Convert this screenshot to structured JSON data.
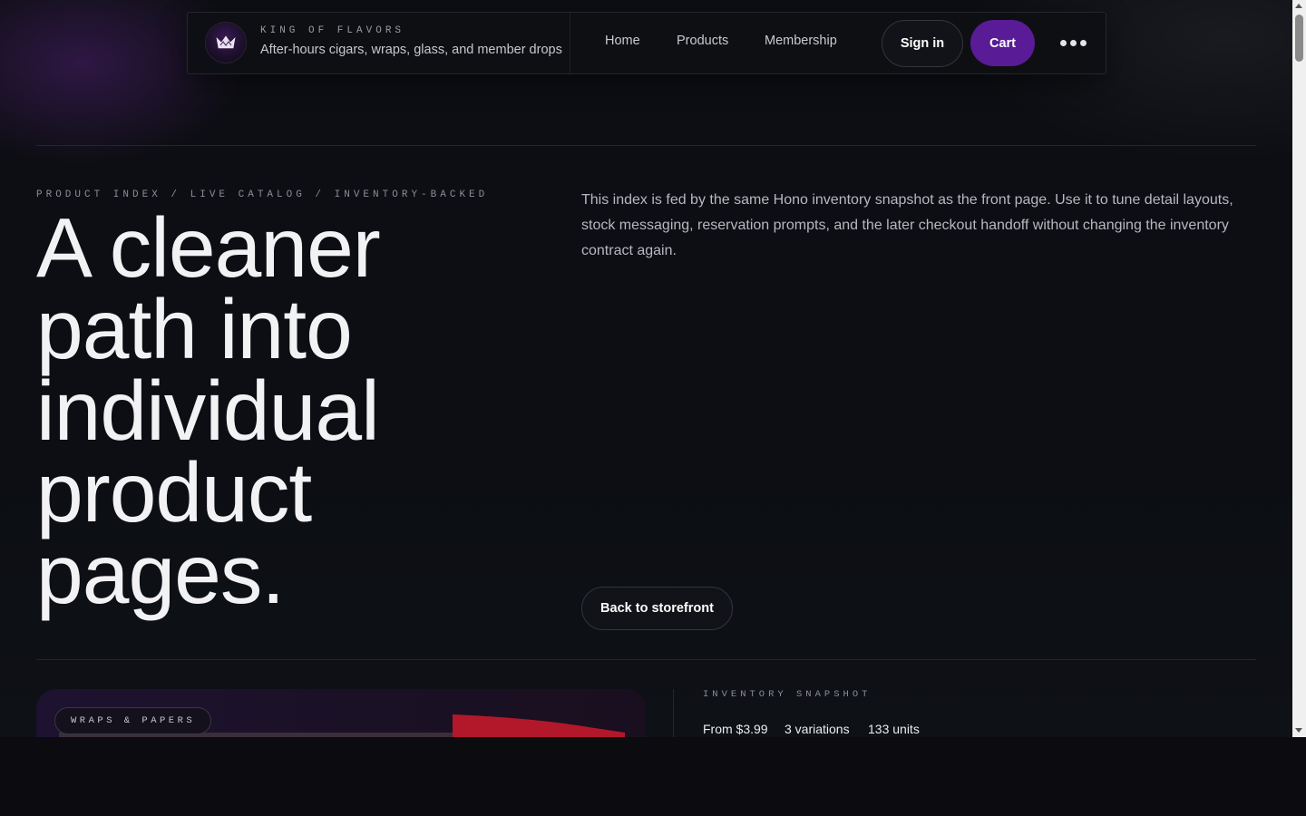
{
  "header": {
    "brand_name": "KING OF FLAVORS",
    "brand_tagline": "After-hours cigars, wraps, glass, and member drops",
    "nav": [
      "Home",
      "Products",
      "Membership"
    ],
    "sign_in_label": "Sign in",
    "cart_label": "Cart",
    "more_icon": "more-horizontal-icon",
    "logo_icon": "crown-icon"
  },
  "hero": {
    "eyebrow": "PRODUCT INDEX / LIVE CATALOG / INVENTORY-BACKED",
    "headline": "A cleaner path into individual product pages.",
    "intro": "This index is fed by the same Hono inventory snapshot as the front page. Use it to tune detail layouts, stock messaging, reservation prompts, and the later checkout handoff without changing the inventory contract again.",
    "back_label": "Back to storefront"
  },
  "product": {
    "category": "WRAPS & PAPERS",
    "snapshot_label": "INVENTORY SNAPSHOT",
    "price": "From $3.99",
    "variations": "3 variations",
    "units": "133 units"
  },
  "colors": {
    "accent": "#5a1b96",
    "background": "#0d0e13",
    "text": "#f2f2f5"
  }
}
